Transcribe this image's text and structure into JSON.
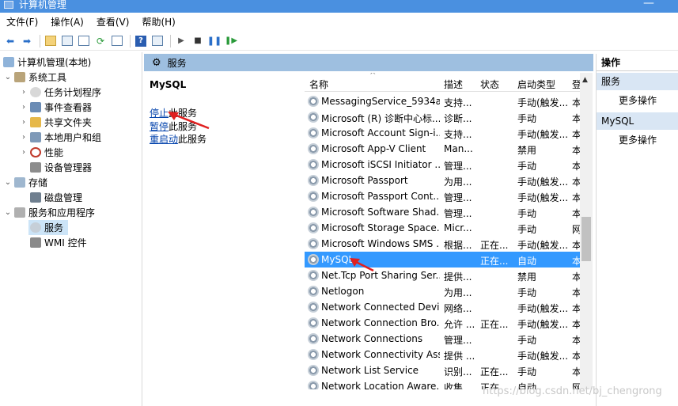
{
  "window": {
    "title": "计算机管理"
  },
  "menu": [
    "文件(F)",
    "操作(A)",
    "查看(V)",
    "帮助(H)"
  ],
  "tree": {
    "root": "计算机管理(本地)",
    "system_tools": "系统工具",
    "task_scheduler": "任务计划程序",
    "event_viewer": "事件查看器",
    "shared_folders": "共享文件夹",
    "local_users": "本地用户和组",
    "performance": "性能",
    "device_manager": "设备管理器",
    "storage": "存储",
    "disk_management": "磁盘管理",
    "services_apps": "服务和应用程序",
    "services": "服务",
    "wmi": "WMI 控件"
  },
  "panel": {
    "header": "服务"
  },
  "desc": {
    "service_name": "MySQL",
    "stop_link": "停止",
    "stop_rest": "此服务",
    "pause_link": "暂停",
    "pause_rest": "此服务",
    "restart_link": "重启动",
    "restart_rest": "此服务"
  },
  "columns": {
    "name": "名称",
    "desc": "描述",
    "status": "状态",
    "startup": "启动类型",
    "logon": "登"
  },
  "services": [
    {
      "name": "MessagingService_5934a",
      "desc": "支持...",
      "status": "",
      "startup": "手动(触发...",
      "logon": "本"
    },
    {
      "name": "Microsoft (R) 诊断中心标...",
      "desc": "诊断...",
      "status": "",
      "startup": "手动",
      "logon": "本"
    },
    {
      "name": "Microsoft Account Sign-i...",
      "desc": "支持...",
      "status": "",
      "startup": "手动(触发...",
      "logon": "本"
    },
    {
      "name": "Microsoft App-V Client",
      "desc": "Man...",
      "status": "",
      "startup": "禁用",
      "logon": "本"
    },
    {
      "name": "Microsoft iSCSI Initiator ...",
      "desc": "管理...",
      "status": "",
      "startup": "手动",
      "logon": "本"
    },
    {
      "name": "Microsoft Passport",
      "desc": "为用...",
      "status": "",
      "startup": "手动(触发...",
      "logon": "本"
    },
    {
      "name": "Microsoft Passport Cont...",
      "desc": "管理...",
      "status": "",
      "startup": "手动(触发...",
      "logon": "本"
    },
    {
      "name": "Microsoft Software Shad...",
      "desc": "管理...",
      "status": "",
      "startup": "手动",
      "logon": "本"
    },
    {
      "name": "Microsoft Storage Space...",
      "desc": "Micr...",
      "status": "",
      "startup": "手动",
      "logon": "网"
    },
    {
      "name": "Microsoft Windows SMS ...",
      "desc": "根据...",
      "status": "正在...",
      "startup": "手动(触发...",
      "logon": "本"
    },
    {
      "name": "MySQL",
      "desc": "",
      "status": "正在...",
      "startup": "自动",
      "logon": "本",
      "selected": true
    },
    {
      "name": "Net.Tcp Port Sharing Ser...",
      "desc": "提供...",
      "status": "",
      "startup": "禁用",
      "logon": "本"
    },
    {
      "name": "Netlogon",
      "desc": "为用...",
      "status": "",
      "startup": "手动",
      "logon": "本"
    },
    {
      "name": "Network Connected Devi...",
      "desc": "网络...",
      "status": "",
      "startup": "手动(触发...",
      "logon": "本"
    },
    {
      "name": "Network Connection Bro...",
      "desc": "允许 ...",
      "status": "正在...",
      "startup": "手动(触发...",
      "logon": "本"
    },
    {
      "name": "Network Connections",
      "desc": "管理...",
      "status": "",
      "startup": "手动",
      "logon": "本"
    },
    {
      "name": "Network Connectivity Ass...",
      "desc": "提供 ...",
      "status": "",
      "startup": "手动(触发...",
      "logon": "本"
    },
    {
      "name": "Network List Service",
      "desc": "识别...",
      "status": "正在...",
      "startup": "手动",
      "logon": "本"
    },
    {
      "name": "Network Location Aware...",
      "desc": "收集...",
      "status": "正在...",
      "startup": "自动",
      "logon": "网"
    }
  ],
  "actions": {
    "title": "操作",
    "section_services": "服务",
    "more_1": "更多操作",
    "section_mysql": "MySQL",
    "more_2": "更多操作"
  },
  "watermark": "https://blog.csdn.net/bj_chengrong"
}
